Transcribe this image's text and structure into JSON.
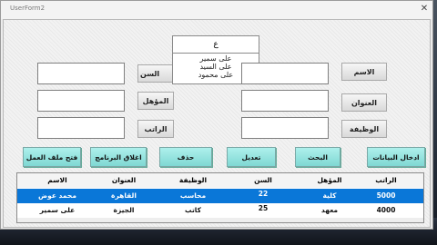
{
  "window": {
    "title": "UserForm2",
    "close": "✕"
  },
  "labels": {
    "name": "الاسم",
    "address": "العنوان",
    "job": "الوظيفة",
    "age": "السن",
    "qualification": "المؤهل",
    "salary": "الراتب"
  },
  "search_list": {
    "query": "ع",
    "items": [
      "على سمير",
      "على السيد",
      "على محمود"
    ]
  },
  "buttons": {
    "enter_data": "ادخال البيانات",
    "search": "البحث",
    "edit": "تعديل",
    "delete": "حذف",
    "close_program": "اغلاق البرنامج",
    "open_file": "فتح ملف العمل"
  },
  "grid": {
    "headers": [
      "الراتب",
      "المؤهل",
      "السن",
      "الوظيفة",
      "العنوان",
      "الاسم"
    ],
    "rows": [
      [
        "5000",
        "كلية",
        "22",
        "محاسب",
        "القاهرة",
        "محمد عوض"
      ],
      [
        "4000",
        "معهد",
        "25",
        "كاتب",
        "الجيزة",
        "على سمير"
      ]
    ]
  },
  "colors": {
    "accent_button": "#7fd8d3",
    "selected_row": "#0a77d8"
  }
}
